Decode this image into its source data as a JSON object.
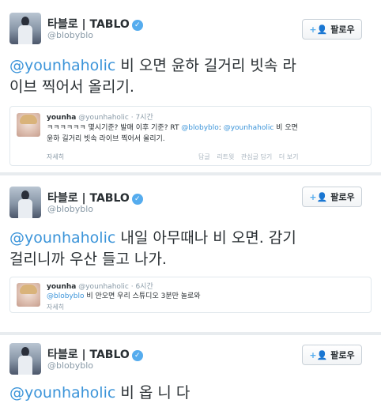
{
  "tweets": [
    {
      "name": "타블로 | TABLO",
      "handle": "@blobyblo",
      "follow_label": "팔로우",
      "mention": "@younhaholic",
      "text_line1": " 비 오면 윤하 길거리 빗속 라",
      "text_line2": "이브 찍어서 올리기.",
      "reply": {
        "name": "younha",
        "handle": "@younhaholic",
        "time": "· 7시간",
        "text_prefix": "ㅋㅋㅋㅋㅋㅋ 몇시기준? 발매 이후 기준? RT ",
        "mention1": "@blobyblo",
        "mention_sep": ": ",
        "mention2": "@younhaholic",
        "text_suffix": " 비 오면",
        "text_line2": "윤하 길거리 빗속 라이브 찍어서 올리기.",
        "detail": "자세히",
        "actions": [
          "답글",
          "리트윗",
          "관심글 담기",
          "더 보기"
        ]
      }
    },
    {
      "name": "타블로 | TABLO",
      "handle": "@blobyblo",
      "follow_label": "팔로우",
      "mention": "@younhaholic",
      "text_line1": " 내일 아무때나 비 오면. 감기",
      "text_line2": "걸리니까 우산 들고 나가.",
      "reply": {
        "name": "younha",
        "handle": "@younhaholic",
        "time": "· 6시간",
        "mention1": "@blobyblo",
        "text_suffix": " 비 안오면 우리 스튜디오 3분만 놀로와",
        "detail": "자세히"
      }
    },
    {
      "name": "타블로 | TABLO",
      "handle": "@blobyblo",
      "follow_label": "팔로우",
      "mention": "@younhaholic",
      "text_line1": " 비 옵 니 다"
    }
  ],
  "icons": {
    "verified": "verified-check-icon",
    "follow": "add-user-icon"
  },
  "colors": {
    "link": "#3b94d9",
    "verified": "#55acee",
    "muted": "#8899a6"
  }
}
